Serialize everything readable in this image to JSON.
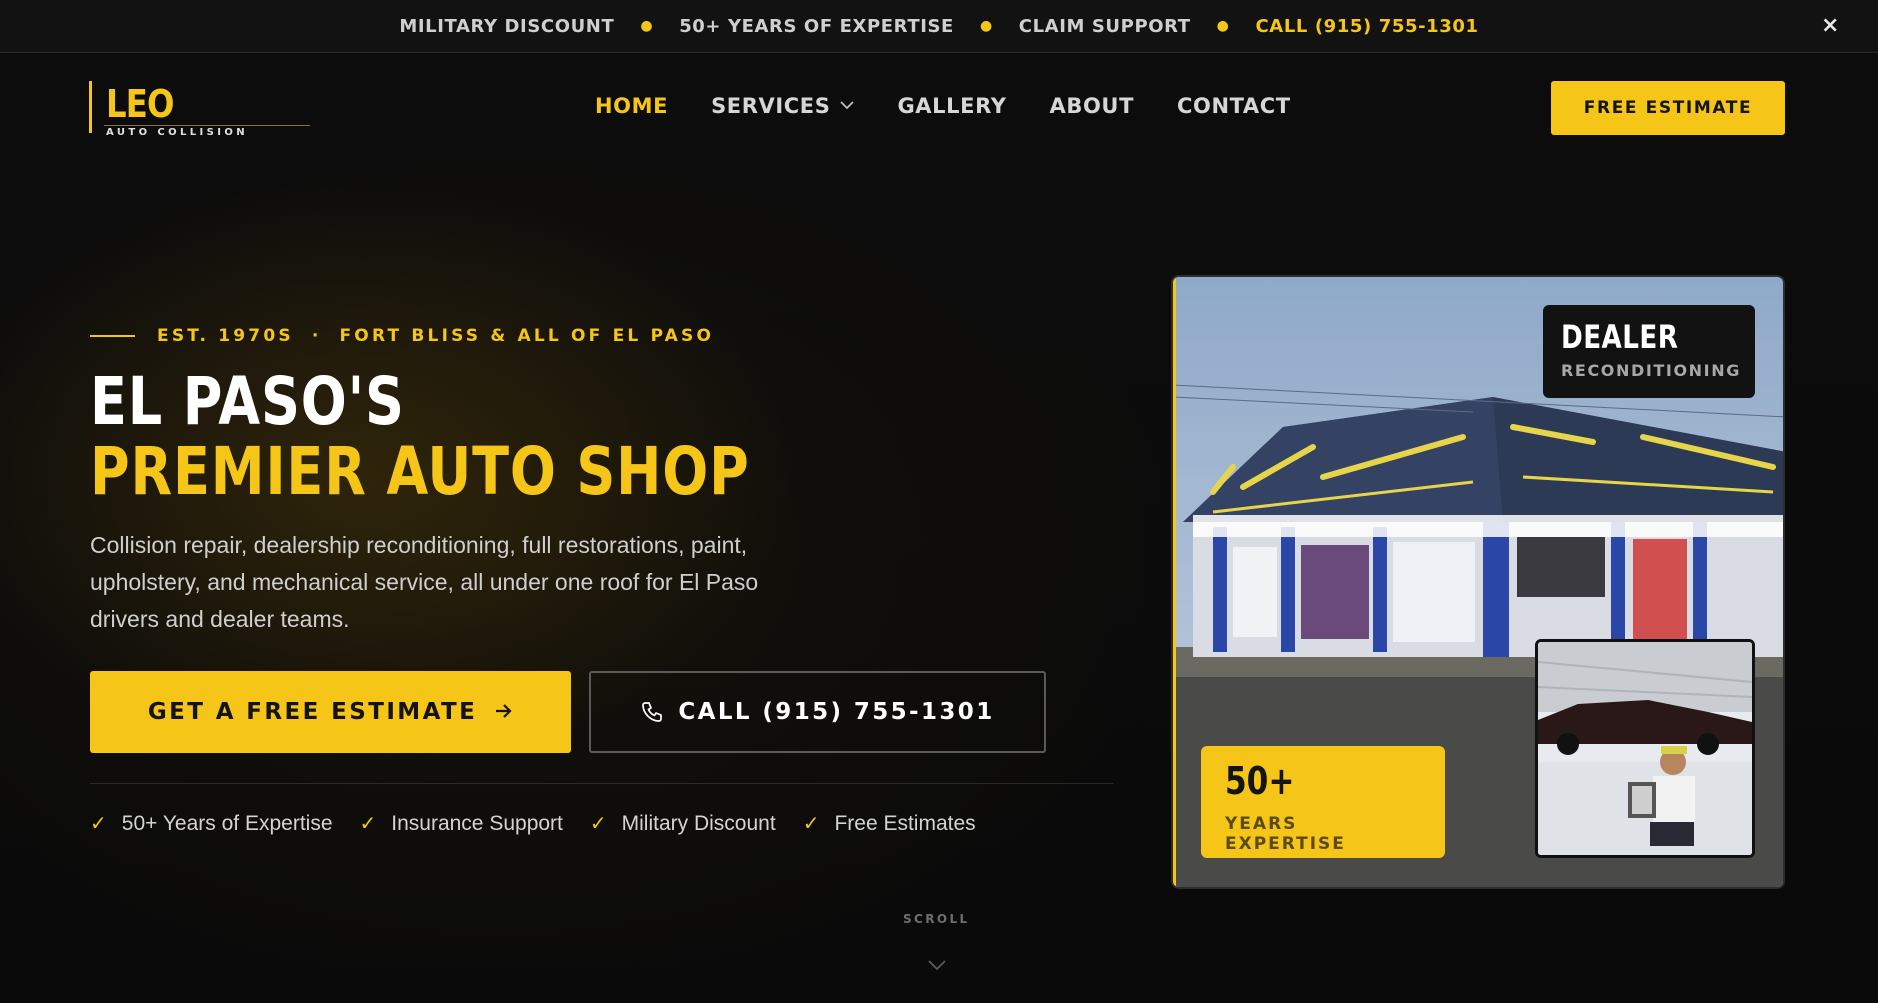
{
  "topbar": {
    "items": [
      "MILITARY DISCOUNT",
      "50+ YEARS OF EXPERTISE",
      "CLAIM SUPPORT"
    ],
    "phone": "CALL (915) 755-1301",
    "close": "×"
  },
  "logo": {
    "name": "LEO",
    "tagline": "AUTO COLLISION"
  },
  "nav": {
    "items": [
      "HOME",
      "SERVICES",
      "GALLERY",
      "ABOUT",
      "CONTACT"
    ],
    "active": "HOME",
    "cta": "FREE ESTIMATE"
  },
  "hero": {
    "eyebrow_est": "EST. 1970S",
    "eyebrow_sep": "·",
    "eyebrow_area": "FORT BLISS & ALL OF EL PASO",
    "title_line1": "EL PASO'S",
    "title_line2": "PREMIER AUTO SHOP",
    "description": "Collision repair, dealership reconditioning, full restorations, paint, upholstery, and mechanical service, all under one roof for El Paso drivers and dealer teams.",
    "primary_button": "GET A FREE ESTIMATE",
    "call_button": "CALL (915) 755-1301",
    "features": [
      "50+ Years of Expertise",
      "Insurance Support",
      "Military Discount",
      "Free Estimates"
    ],
    "scroll_label": "SCROLL"
  },
  "card": {
    "dealer_title": "DEALER",
    "dealer_sub": "RECONDITIONING",
    "years_value": "50+",
    "years_label": "YEARS EXPERTISE"
  },
  "colors": {
    "accent": "#f5c518",
    "background": "#0b0b0b"
  }
}
